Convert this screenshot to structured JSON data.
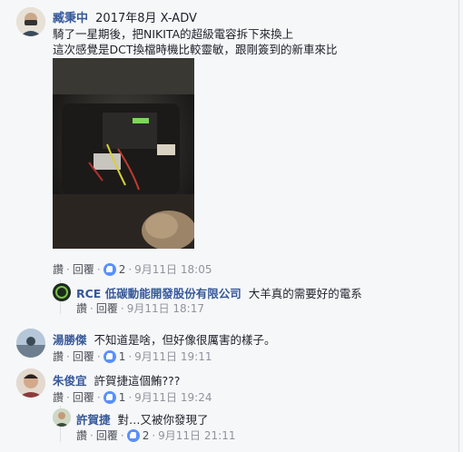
{
  "comments": [
    {
      "author": "臧秉中",
      "headline": "2017年8月 X-ADV",
      "lines": [
        "騎了一星期後，把NIKITA的超級電容拆下來換上",
        "這次感覺是DCT換檔時機比較靈敏，跟剛簽到的新車來比"
      ],
      "like_label": "讚",
      "reply_label": "回覆",
      "reactions": "2",
      "date": "9月11日 18:05"
    },
    {
      "author": "RCE 低碳動能開發股份有限公司",
      "text": "大羊真的需要好的電系",
      "like_label": "讚",
      "reply_label": "回覆",
      "date": "9月11日 18:17"
    },
    {
      "author": "湯勝傑",
      "text": "不知道是啥，但好像很厲害的樣子。",
      "like_label": "讚",
      "reply_label": "回覆",
      "reactions": "1",
      "date": "9月11日 19:11"
    },
    {
      "author": "朱俊宜",
      "text": "許賀捷這個鮪???",
      "like_label": "讚",
      "reply_label": "回覆",
      "reactions": "1",
      "date": "9月11日 19:24"
    },
    {
      "author": "許賀捷",
      "text": "對…又被你發現了",
      "like_label": "讚",
      "reply_label": "回覆",
      "reactions": "2",
      "date": "9月11日 21:11"
    }
  ],
  "colors": {
    "name": "#365899",
    "meta": "#90949c",
    "like_badge": "#5890ff",
    "background": "#f6f7f9"
  },
  "icons": {
    "like": "thumbs-up-icon"
  }
}
